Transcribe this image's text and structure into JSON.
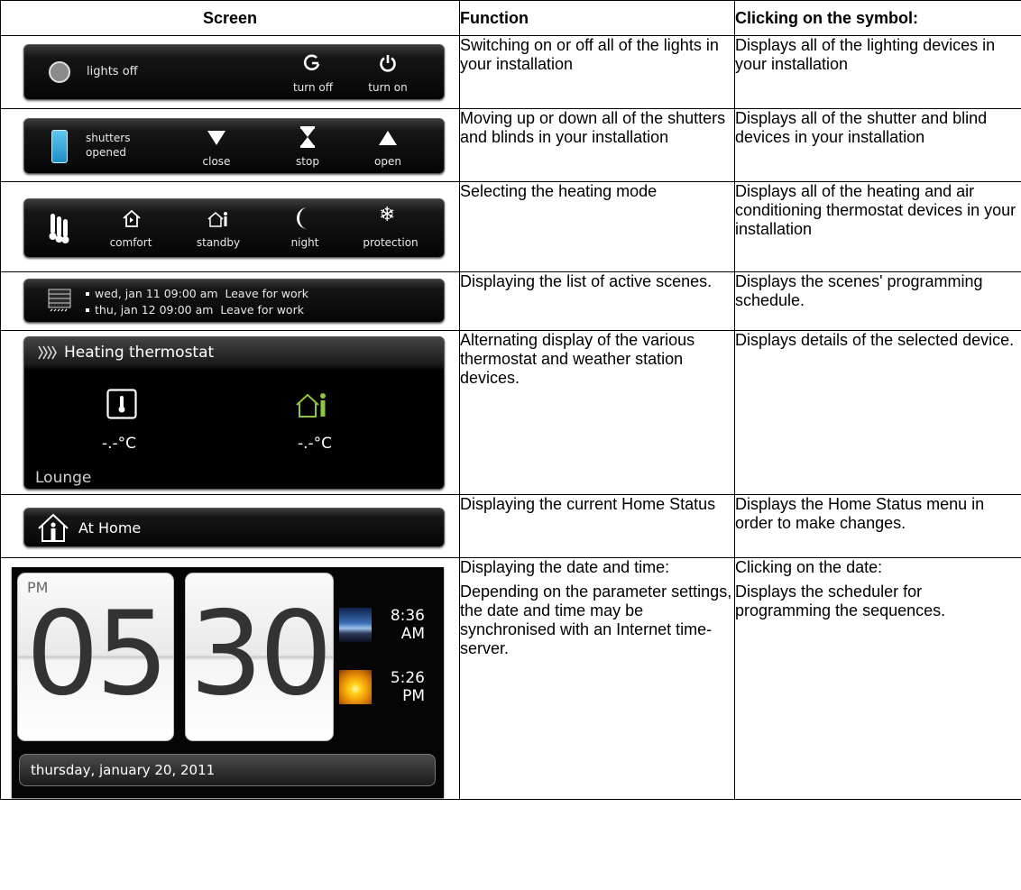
{
  "headers": {
    "screen": "Screen",
    "function": "Function",
    "clicking": "Clicking on the symbol:"
  },
  "rows": [
    {
      "function": "Switching on or off all of the lights in your installation",
      "clicking": "Displays all of the lighting devices in your installation",
      "panel": {
        "status_label": "lights off",
        "btn1_label": "turn off",
        "btn2_label": "turn on",
        "icons": [
          "lamp-status-icon",
          "turn-off-icon",
          "power-icon"
        ]
      }
    },
    {
      "function": "Moving up or down all of the shutters and blinds in your installation",
      "clicking": "Displays all of the shutter and blind devices in your installation",
      "panel": {
        "status_line1": "shutters",
        "status_line2": "opened",
        "close_label": "close",
        "stop_label": "stop",
        "open_label": "open",
        "icons": [
          "shutter-status-icon",
          "down-triangle-icon",
          "hourglass-stop-icon",
          "up-triangle-icon"
        ]
      }
    },
    {
      "function": "Selecting the heating mode",
      "clicking": "Displays all of the heating and air conditioning thermostat devices in your installation",
      "panel": {
        "comfort_label": "comfort",
        "standby_label": "standby",
        "night_label": "night",
        "protection_label": "protection",
        "icons": [
          "thermometer-group-icon",
          "comfort-house-icon",
          "standby-house-icon",
          "moon-icon",
          "snowflake-icon"
        ]
      }
    },
    {
      "function": "Displaying the list of active scenes.",
      "clicking": "Displays the scenes' programming schedule.",
      "panel": {
        "scene1": "wed, jan 11 09:00 am  Leave for work",
        "scene2": "thu, jan 12 09:00 am  Leave for work",
        "icons": [
          "scene-shutter-icon"
        ]
      }
    },
    {
      "function": "Alternating display of the various thermostat and weather station devices.",
      "clicking": "Displays details of the selected device.",
      "panel": {
        "title": "Heating thermostat",
        "temp1": "-.-°C",
        "temp2": "-.-°C",
        "room": "Lounge",
        "icons": [
          "heating-waves-icon",
          "thermometer-icon",
          "standby-house-icon"
        ]
      }
    },
    {
      "function": "Displaying the current Home Status",
      "clicking": "Displays the Home Status menu in order to make changes.",
      "panel": {
        "status": "At Home",
        "icons": [
          "home-person-icon"
        ]
      }
    },
    {
      "function_p1": "Displaying the date and time:",
      "function_p2": "Depending on the parameter settings, the date and time may be synchronised with an Internet time-server.",
      "clicking_p1": "Clicking on the date:",
      "clicking_p2": "Displays the scheduler for programming the sequences.",
      "panel": {
        "ampm": "PM",
        "hours": "05",
        "minutes": "30",
        "sunrise_time": "8:36",
        "sunrise_ampm": "AM",
        "sunset_time": "5:26",
        "sunset_ampm": "PM",
        "date": "thursday, january 20, 2011",
        "icons": [
          "sunrise-image",
          "sunset-image"
        ]
      }
    }
  ],
  "colors": {
    "panel_bg": "#0a0a0a",
    "panel_text": "#ffffff",
    "standby_green": "#8dc63f",
    "shutter_blue": "#29a8e0"
  }
}
